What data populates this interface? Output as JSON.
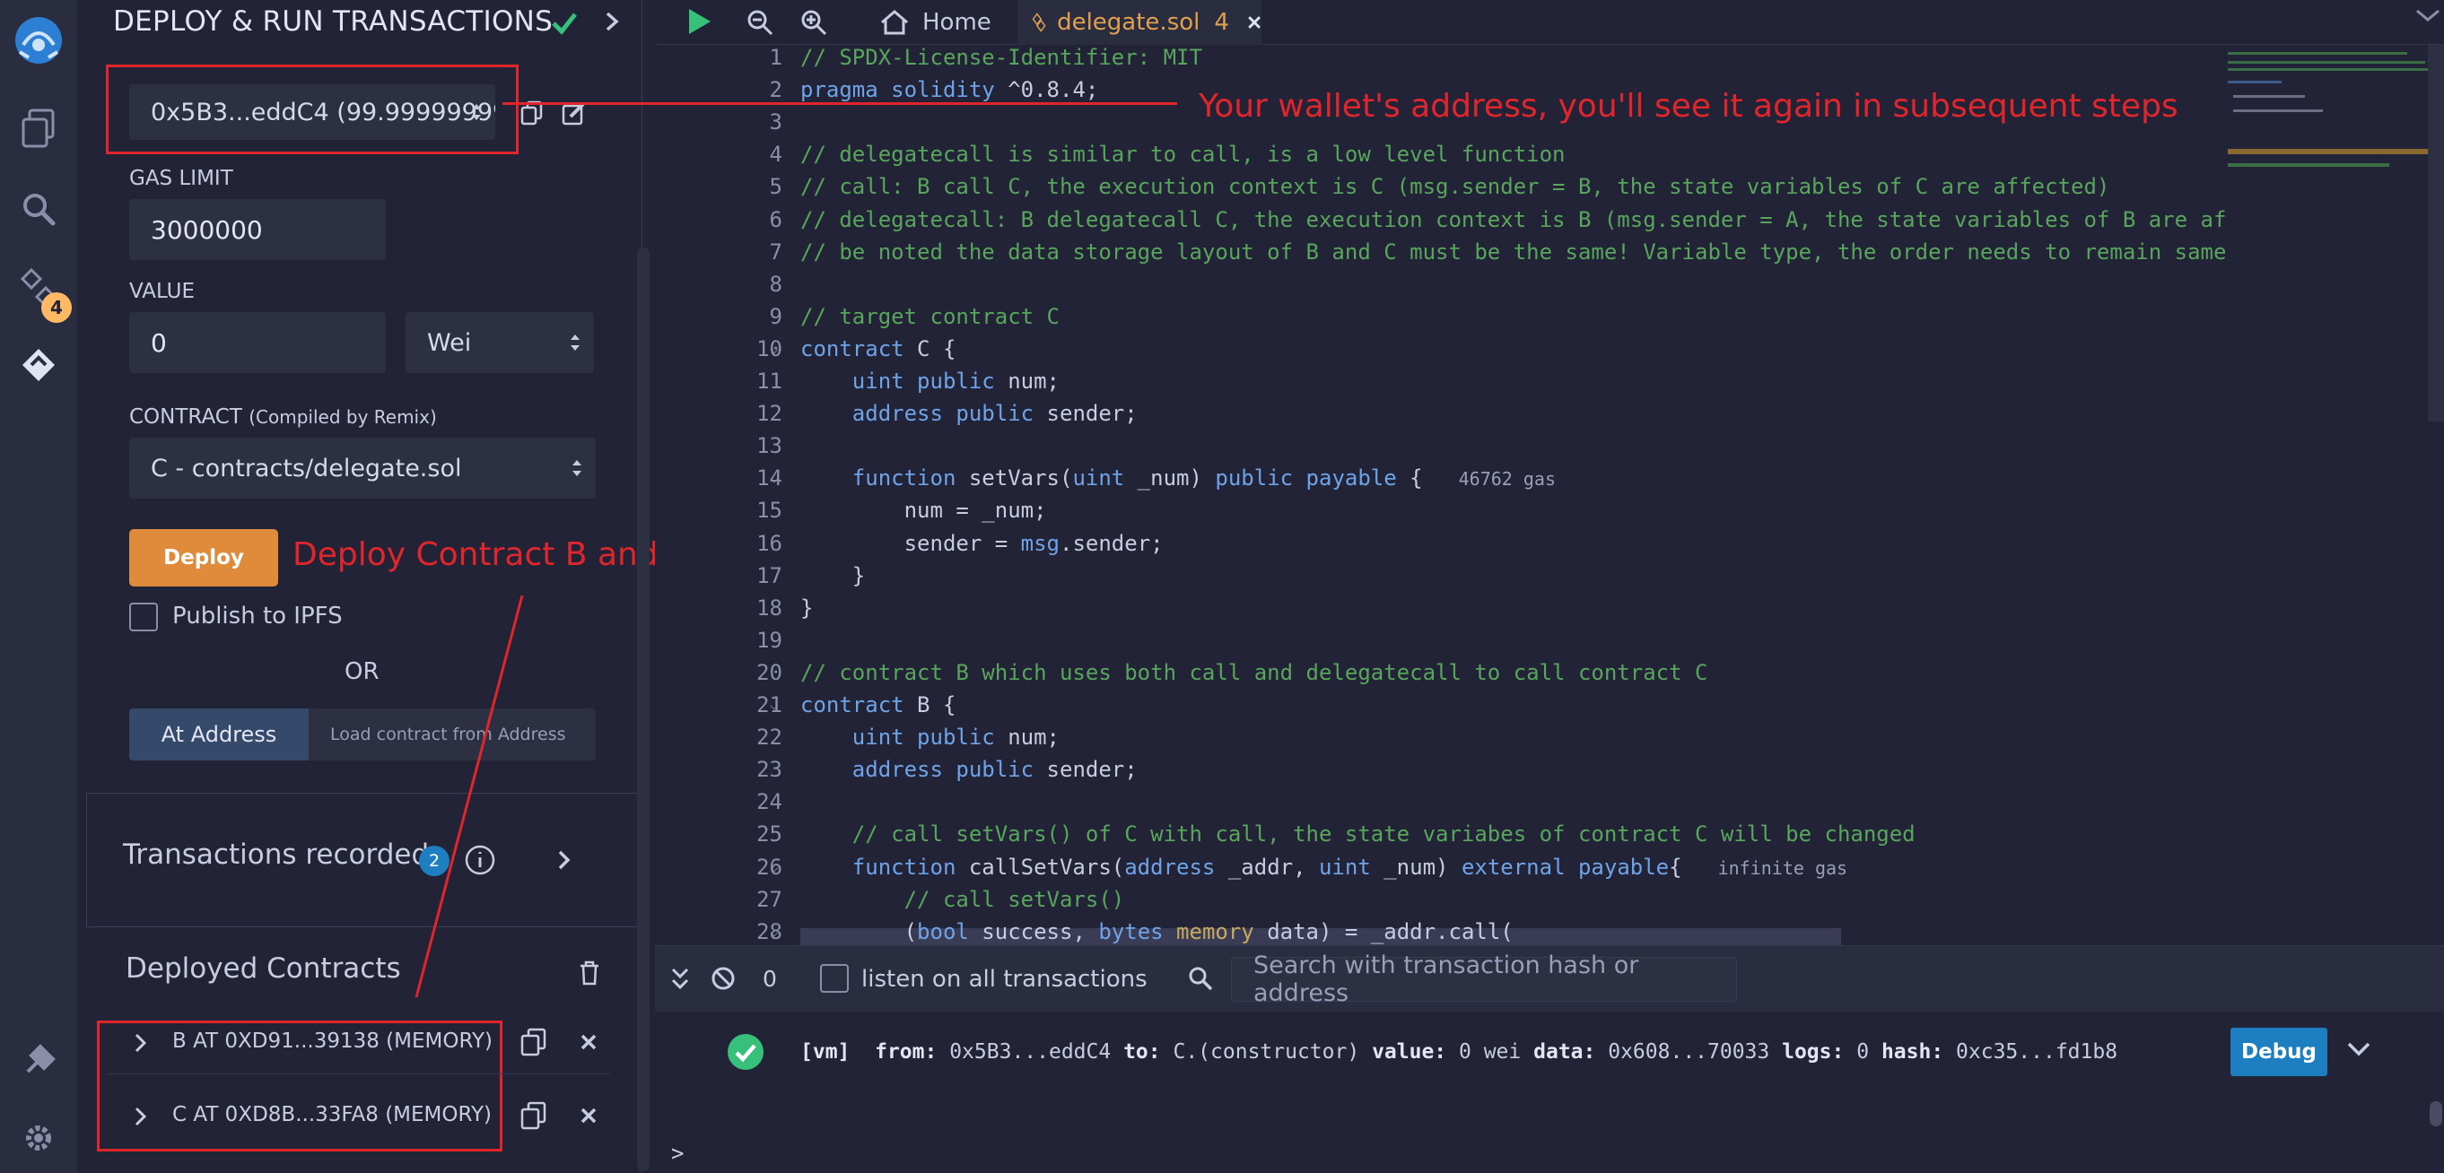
{
  "panel": {
    "title": "DEPLOY & RUN TRANSACTIONS",
    "account": "0x5B3...eddC4 (99.99999999",
    "gas_limit_label": "GAS LIMIT",
    "gas_limit_value": "3000000",
    "value_label": "VALUE",
    "value_amount": "0",
    "value_unit": "Wei",
    "contract_label": "CONTRACT",
    "contract_sub": "(Compiled by Remix)",
    "contract_value": "C - contracts/delegate.sol",
    "deploy_label": "Deploy",
    "publish_label": "Publish to IPFS",
    "or_label": "OR",
    "at_address_label": "At Address",
    "load_placeholder": "Load contract from Address",
    "transactions_label": "Transactions recorded",
    "transactions_count": "2",
    "deployed_label": "Deployed Contracts",
    "contracts": [
      {
        "label": "B AT 0XD91...39138 (MEMORY)"
      },
      {
        "label": "C AT 0XD8B...33FA8 (MEMORY)"
      }
    ]
  },
  "rail": {
    "plugin_badge": "4"
  },
  "annotations": {
    "wallet": "Your wallet's address, you'll see it again in subsequent steps",
    "deploy": "Deploy Contract B and C"
  },
  "tabs": {
    "home": "Home",
    "file": "delegate.sol",
    "file_badge": "4"
  },
  "code": {
    "lines": [
      {
        "n": "1",
        "t": "// SPDX-License-Identifier: MIT"
      },
      {
        "n": "2",
        "t": "pragma solidity ^0.8.4;"
      },
      {
        "n": "3",
        "t": ""
      },
      {
        "n": "4",
        "t": "// delegatecall is similar to call, is a low level function"
      },
      {
        "n": "5",
        "t": "// call: B call C, the execution context is C (msg.sender = B, the state variables of C are affected)"
      },
      {
        "n": "6",
        "t": "// delegatecall: B delegatecall C, the execution context is B (msg.sender = A, the state variables of B are af"
      },
      {
        "n": "7",
        "t": "// be noted the data storage layout of B and C must be the same! Variable type, the order needs to remain same"
      },
      {
        "n": "8",
        "t": ""
      },
      {
        "n": "9",
        "t": "// target contract C"
      },
      {
        "n": "10",
        "t": "contract C {"
      },
      {
        "n": "11",
        "t": "    uint public num;"
      },
      {
        "n": "12",
        "t": "    address public sender;"
      },
      {
        "n": "13",
        "t": ""
      },
      {
        "n": "14",
        "t": "    function setVars(uint _num) public payable {"
      },
      {
        "n": "15",
        "t": "        num = _num;"
      },
      {
        "n": "16",
        "t": "        sender = msg.sender;"
      },
      {
        "n": "17",
        "t": "    }"
      },
      {
        "n": "18",
        "t": "}"
      },
      {
        "n": "19",
        "t": ""
      },
      {
        "n": "20",
        "t": "// contract B which uses both call and delegatecall to call contract C"
      },
      {
        "n": "21",
        "t": "contract B {"
      },
      {
        "n": "22",
        "t": "    uint public num;"
      },
      {
        "n": "23",
        "t": "    address public sender;"
      },
      {
        "n": "24",
        "t": ""
      },
      {
        "n": "25",
        "t": "    // call setVars() of C with call, the state variabes of contract C will be changed"
      },
      {
        "n": "26",
        "t": "    function callSetVars(address _addr, uint _num) external payable{"
      },
      {
        "n": "27",
        "t": "        // call setVars()"
      },
      {
        "n": "28",
        "t": "        (bool success, bytes memory data) = _addr.call("
      }
    ],
    "gas_14": "46762 gas",
    "gas_26": "infinite gas"
  },
  "terminal": {
    "count": "0",
    "listen_label": "listen on all transactions",
    "search_placeholder": "Search with transaction hash or address",
    "vm": "[vm]",
    "from_label": "from:",
    "from": "0x5B3...eddC4",
    "to_label": "to:",
    "to": "C.(constructor)",
    "value_label": "value:",
    "value": "0 wei",
    "data_label": "data:",
    "data": "0x608...70033",
    "logs_label": "logs:",
    "logs": "0",
    "hash_label": "hash:",
    "hash": "0xc35...fd1b8",
    "debug": "Debug",
    "prompt": ">"
  }
}
